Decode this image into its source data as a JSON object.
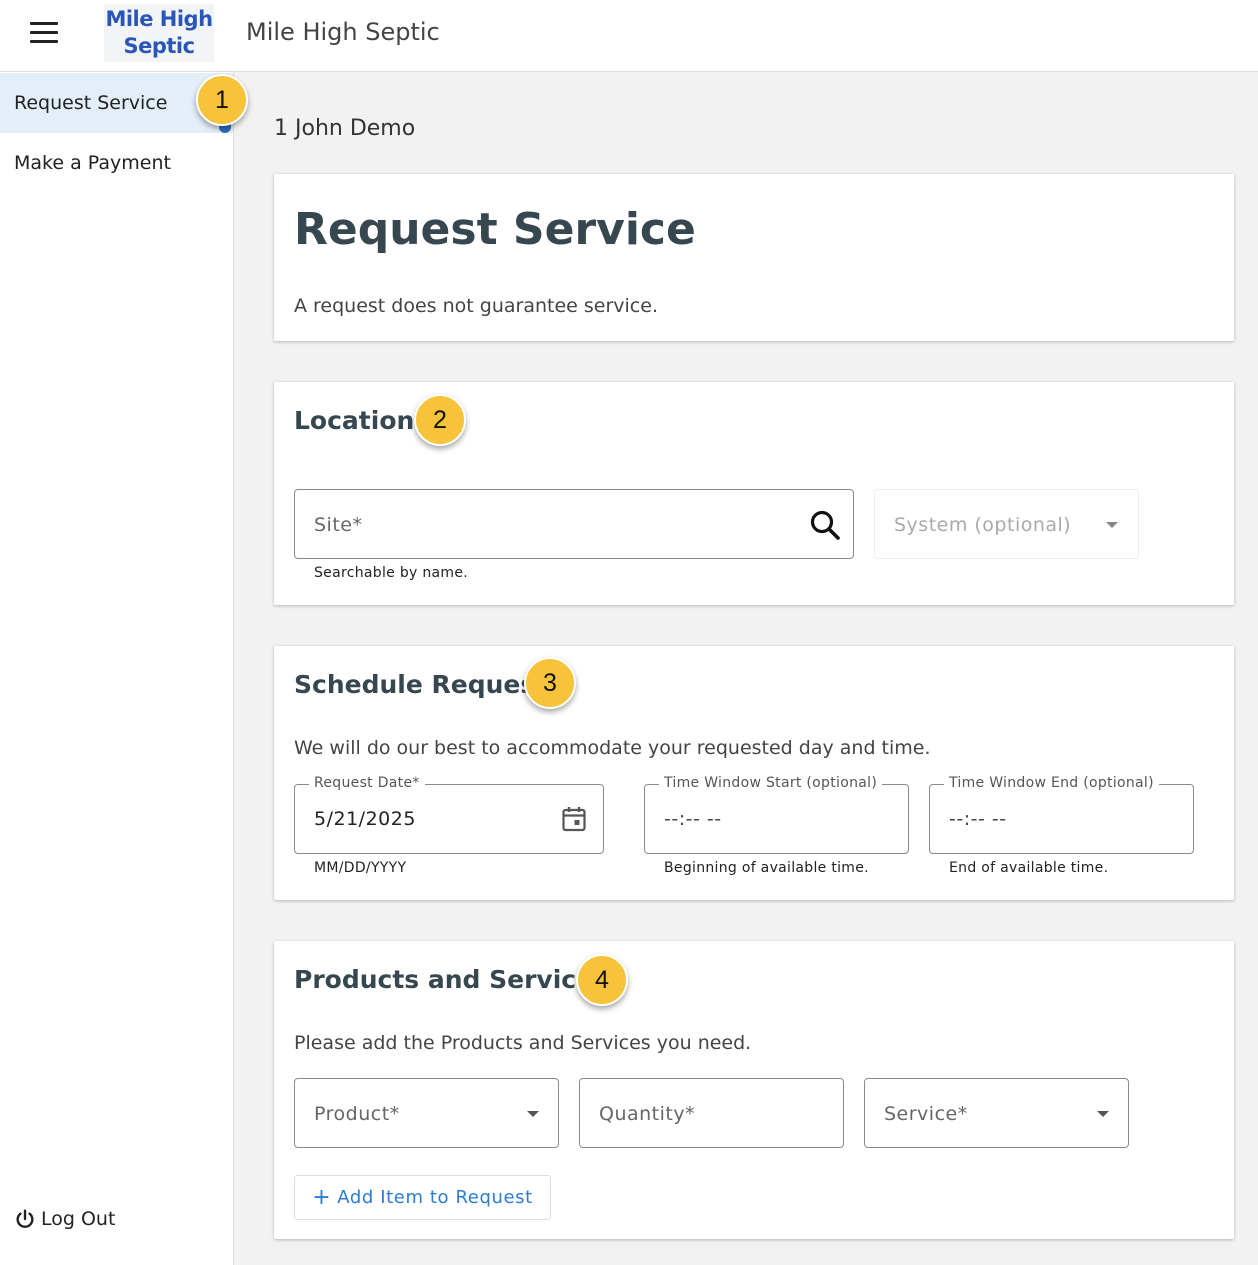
{
  "header": {
    "logo_line1": "Mile High",
    "logo_line2": "Septic",
    "app_title": "Mile High Septic"
  },
  "sidebar": {
    "items": [
      {
        "label": "Request Service",
        "active": true
      },
      {
        "label": "Make a Payment",
        "active": false
      }
    ],
    "logout_label": "Log Out"
  },
  "callouts": [
    "1",
    "2",
    "3",
    "4"
  ],
  "account_name": "1 John Demo",
  "intro": {
    "title": "Request Service",
    "notice": "A request does not guarantee service."
  },
  "location": {
    "title": "Location",
    "site_placeholder": "Site*",
    "site_hint": "Searchable by name.",
    "system_placeholder": "System (optional)"
  },
  "schedule": {
    "title": "Schedule Request",
    "description": "We will do our best to accommodate your requested day and time.",
    "date_label": "Request Date*",
    "date_value": "5/21/2025",
    "date_hint": "MM/DD/YYYY",
    "start_label": "Time Window Start (optional)",
    "start_value": "--:-- --",
    "start_hint": "Beginning of available time.",
    "end_label": "Time Window End (optional)",
    "end_value": "--:-- --",
    "end_hint": "End of available time."
  },
  "products": {
    "title": "Products and Services",
    "description": "Please add the Products and Services you need.",
    "product_placeholder": "Product*",
    "quantity_placeholder": "Quantity*",
    "service_placeholder": "Service*",
    "add_plus": "+",
    "add_label": "Add Item to Request"
  },
  "colors": {
    "accent": "#2b7cd3",
    "callout": "#f6c33a",
    "nav_active_bg": "#e3eef9",
    "heading": "#37474f"
  },
  "icons": [
    "menu-icon",
    "search-icon",
    "calendar-icon",
    "dropdown-caret-icon",
    "power-icon"
  ]
}
